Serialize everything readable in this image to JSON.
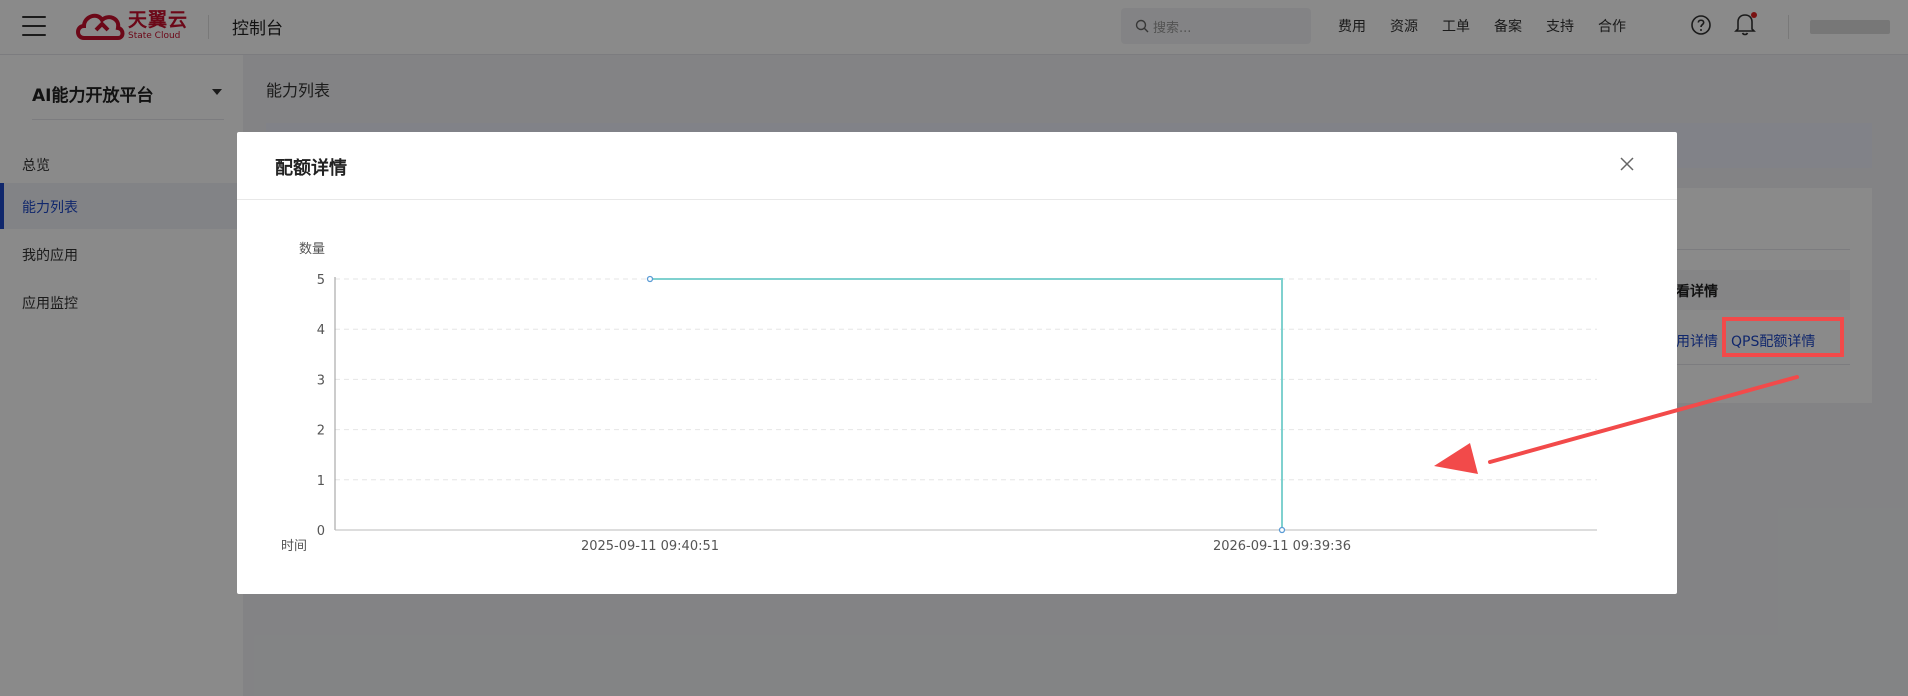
{
  "header": {
    "logo_cn": "天翼云",
    "logo_en": "State Cloud",
    "console": "控制台",
    "search_placeholder": "搜索...",
    "nav": [
      "费用",
      "资源",
      "工单",
      "备案",
      "支持",
      "合作"
    ]
  },
  "sidebar": {
    "platform": "AI能力开放平台",
    "items": [
      {
        "label": "总览"
      },
      {
        "label": "能力列表"
      },
      {
        "label": "我的应用"
      },
      {
        "label": "应用监控"
      }
    ]
  },
  "main": {
    "page_title": "能力列表",
    "table_header": "看详情",
    "link_usage": "用详情",
    "link_qps": "QPS配额详情"
  },
  "modal": {
    "title": "配额详情"
  },
  "chart_data": {
    "type": "line",
    "step": true,
    "ylabel": "数量",
    "xlabel": "时间",
    "yticks": [
      0,
      1,
      2,
      3,
      4,
      5
    ],
    "ylim": [
      0,
      5
    ],
    "x": [
      "2025-09-11 09:40:51",
      "2026-09-11 09:39:36"
    ],
    "series": [
      {
        "values": [
          5,
          0
        ]
      }
    ],
    "grid": true,
    "color": "#7fd1cf",
    "point_color": "#5b9bd5"
  },
  "colors": {
    "accent": "#1f48c8",
    "brand": "#c8102e",
    "annotation": "#f24a4a"
  }
}
